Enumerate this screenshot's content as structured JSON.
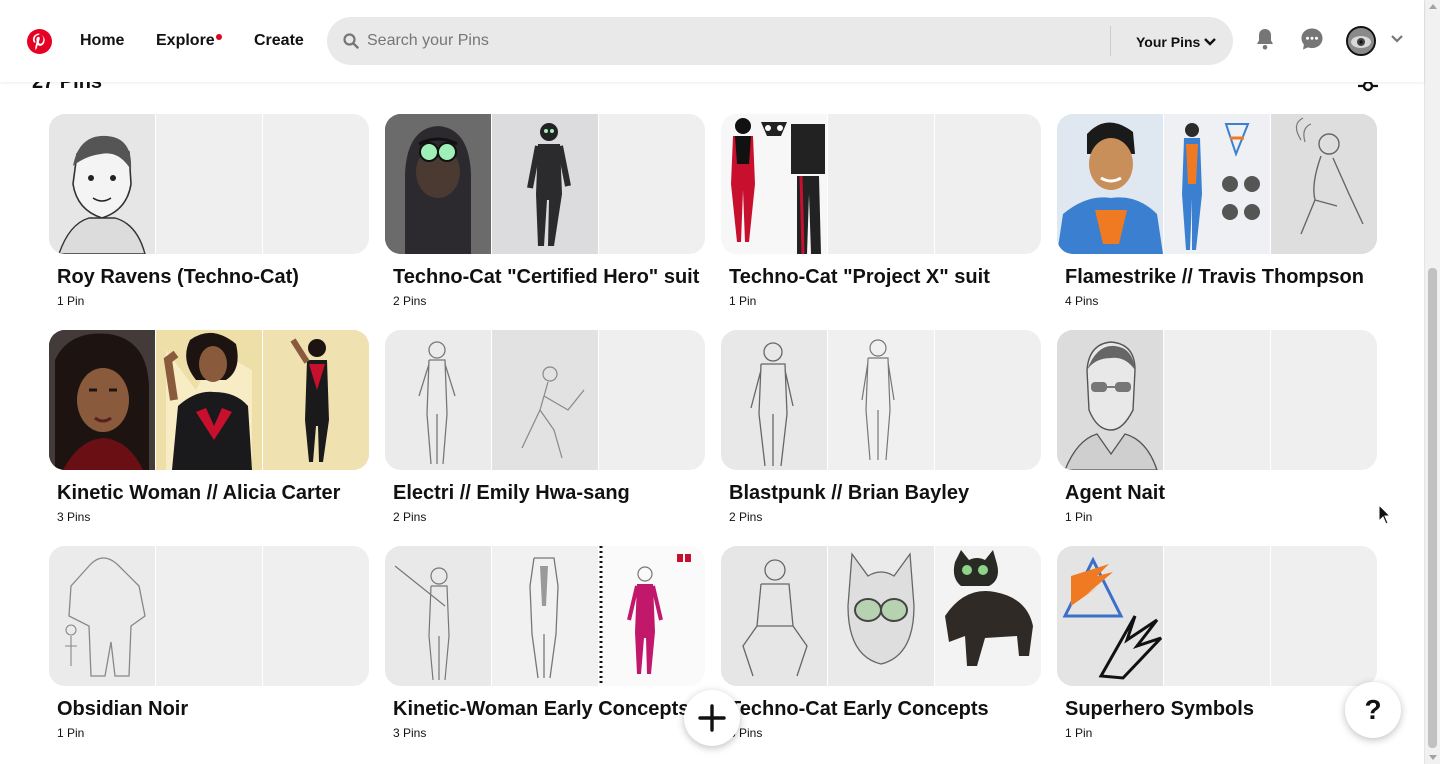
{
  "colors": {
    "brand": "#e60023",
    "search_bg": "#e9e9e9",
    "placeholder_tile": "#efefef"
  },
  "header": {
    "logo_icon": "pinterest-logo",
    "nav": {
      "home": "Home",
      "explore": "Explore",
      "create": "Create"
    },
    "search": {
      "placeholder": "Search your Pins",
      "icon": "search-icon"
    },
    "scope_label": "Your Pins",
    "icons": [
      "bell-icon",
      "chat-icon",
      "avatar",
      "chevron-down-icon"
    ]
  },
  "main": {
    "pin_count": "27 Pins",
    "boards": [
      {
        "title": "Roy Ravens (Techno-Cat)",
        "count": "1 Pin"
      },
      {
        "title": "Techno-Cat \"Certified Hero\" suit",
        "count": "2 Pins"
      },
      {
        "title": "Techno-Cat \"Project X\" suit",
        "count": "1 Pin"
      },
      {
        "title": "Flamestrike // Travis Thompson",
        "count": "4 Pins"
      },
      {
        "title": "Kinetic Woman // Alicia Carter",
        "count": "3 Pins"
      },
      {
        "title": "Electri // Emily Hwa-sang",
        "count": "2 Pins"
      },
      {
        "title": "Blastpunk // Brian Bayley",
        "count": "2 Pins"
      },
      {
        "title": "Agent Nait",
        "count": "1 Pin"
      },
      {
        "title": "Obsidian Noir",
        "count": "1 Pin"
      },
      {
        "title": "Kinetic-Woman Early Concepts",
        "count": "3 Pins"
      },
      {
        "title": "Techno-Cat Early Concepts",
        "count": "3 Pins"
      },
      {
        "title": "Superhero Symbols",
        "count": "1 Pin"
      }
    ]
  },
  "help_label": "?"
}
